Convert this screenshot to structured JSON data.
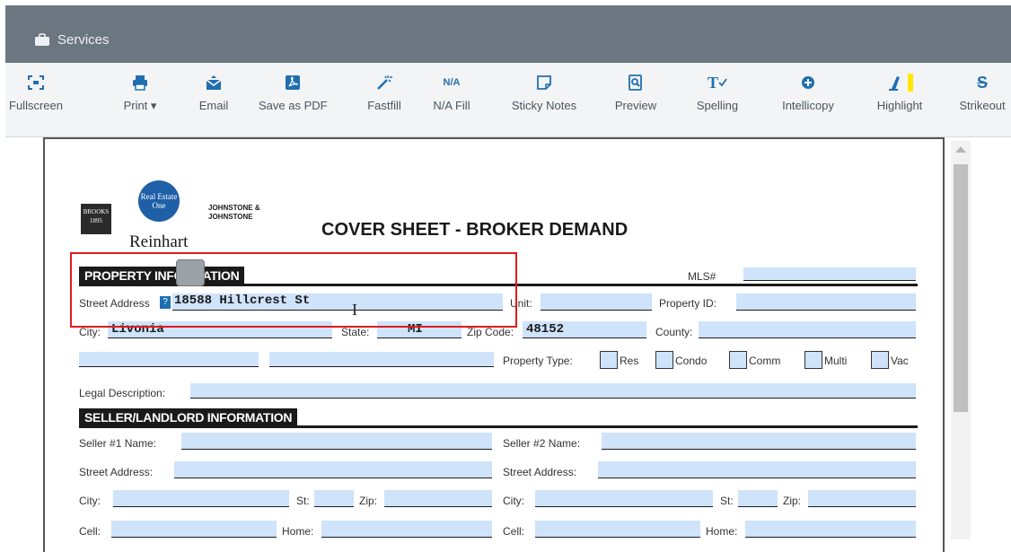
{
  "app": {
    "title": "Services"
  },
  "toolbar": [
    {
      "id": "fullscreen",
      "label": "Fullscreen",
      "icon": "fullscreen-icon"
    },
    {
      "id": "print",
      "label": "Print ▾",
      "icon": "printer-icon"
    },
    {
      "id": "email",
      "label": "Email",
      "icon": "envelope-icon"
    },
    {
      "id": "save-pdf",
      "label": "Save as PDF",
      "icon": "pdf-icon"
    },
    {
      "id": "fastfill",
      "label": "Fastfill",
      "icon": "magic-wand-icon"
    },
    {
      "id": "na-fill",
      "label": "N/A Fill",
      "icon": "na-icon",
      "icon_text": "N/A"
    },
    {
      "id": "sticky-notes",
      "label": "Sticky Notes",
      "icon": "sticky-note-icon"
    },
    {
      "id": "preview",
      "label": "Preview",
      "icon": "preview-icon"
    },
    {
      "id": "spelling",
      "label": "Spelling",
      "icon": "spelling-icon"
    },
    {
      "id": "intellicopy",
      "label": "Intellicopy",
      "icon": "intellicopy-icon"
    },
    {
      "id": "highlight",
      "label": "Highlight",
      "icon": "highlighter-icon"
    },
    {
      "id": "strikeout",
      "label": "Strikeout",
      "icon": "strikeout-icon"
    }
  ],
  "colors": {
    "accent": "#1f6fb0",
    "field_bg": "#cfe3fb",
    "highlight_box": "#e01b1b",
    "topbar": "#6b7680"
  },
  "document": {
    "logos": {
      "left_top": "BROOKS",
      "left_bottom": "1895",
      "real_estate_one": "Real Estate One",
      "johnstone": "JOHNSTONE & JOHNSTONE",
      "reinhart": "Reinhart"
    },
    "title": "COVER SHEET - BROKER DEMAND",
    "property_section": "PROPERTY INFORMATION",
    "labels": {
      "mls": "MLS#",
      "street_address": "Street Address",
      "unit": "Unit:",
      "property_id": "Property ID:",
      "city": "City:",
      "state": "State:",
      "zip_code": "Zip Code:",
      "county": "County:",
      "property_type": "Property Type:",
      "legal_description": "Legal Description:"
    },
    "property_types": [
      "Res",
      "Condo",
      "Comm",
      "Multi",
      "Vac"
    ],
    "values": {
      "street_address": "18588 Hillcrest St",
      "city": "Livonia",
      "state": "MI",
      "zip_code": "48152"
    },
    "seller_section": "SELLER/LANDLORD INFORMATION",
    "seller_labels": {
      "seller1_name": "Seller #1 Name:",
      "seller2_name": "Seller #2 Name:",
      "street_address": "Street Address:",
      "city": "City:",
      "st": "St:",
      "zip": "Zip:",
      "cell": "Cell:",
      "home": "Home:"
    }
  }
}
